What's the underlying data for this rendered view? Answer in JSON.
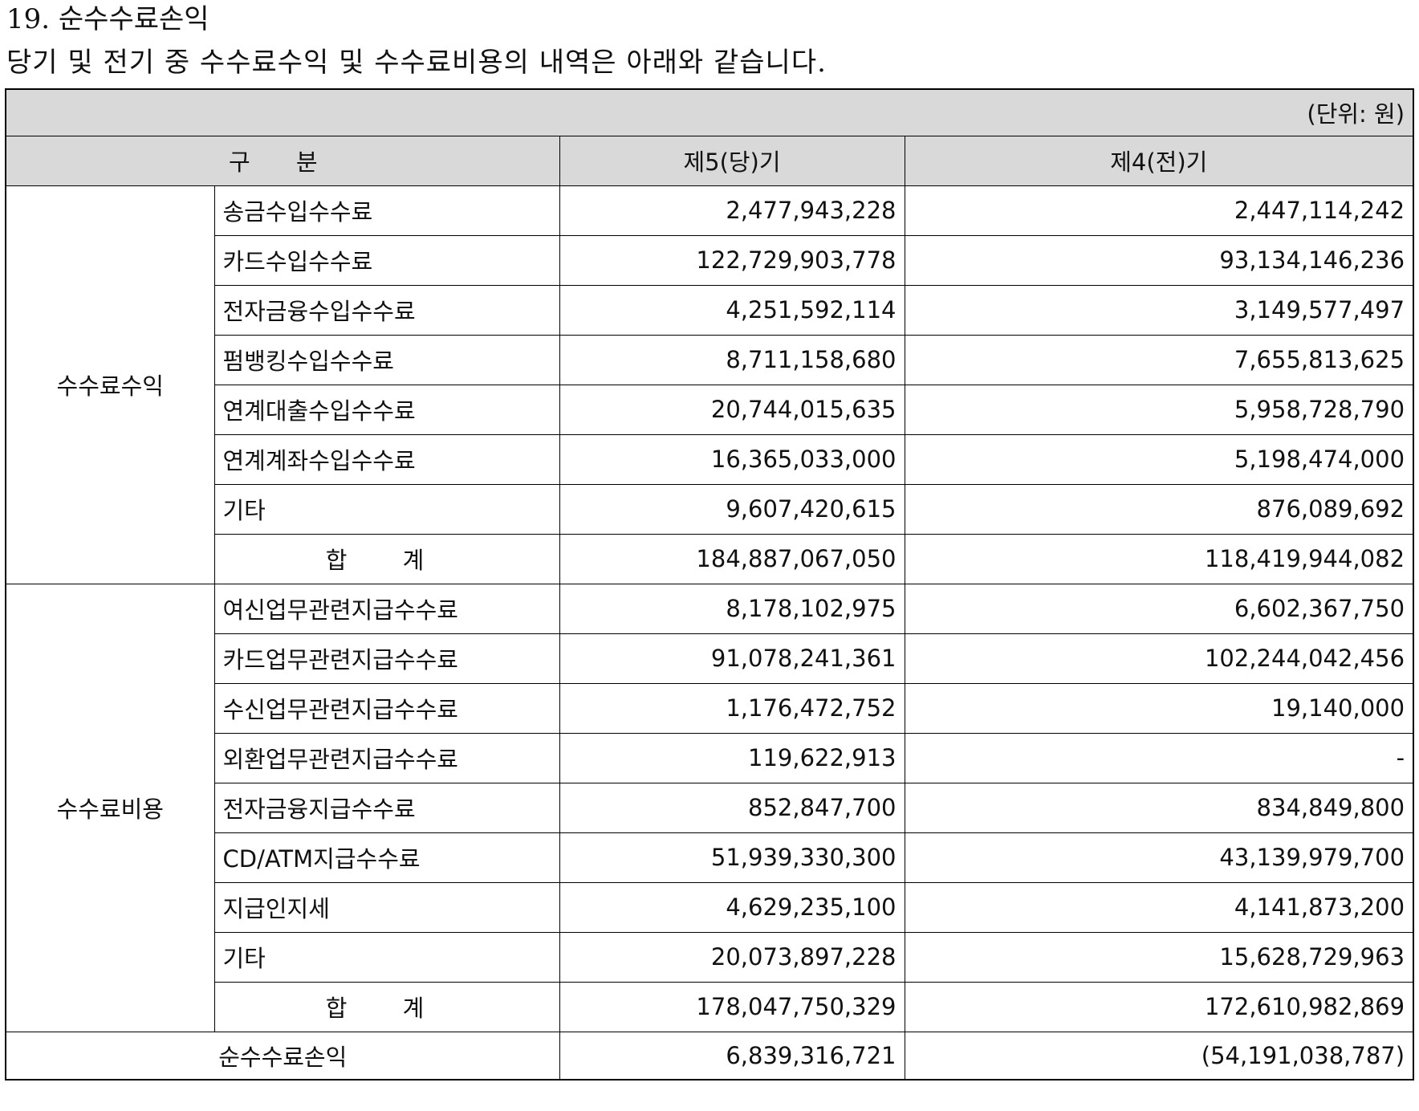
{
  "heading": "19. 순수수료손익",
  "intro": "당기 및 전기 중 수수료수익 및 수수료비용의 내역은 아래와 같습니다.",
  "unit": "(단위: 원)",
  "columns": {
    "category": "구 분",
    "current": "제5(당)기",
    "prior": "제4(전)기"
  },
  "income": {
    "label": "수수료수익",
    "rows": [
      {
        "item": "송금수입수수료",
        "current": "2,477,943,228",
        "prior": "2,447,114,242"
      },
      {
        "item": "카드수입수수료",
        "current": "122,729,903,778",
        "prior": "93,134,146,236"
      },
      {
        "item": "전자금융수입수수료",
        "current": "4,251,592,114",
        "prior": "3,149,577,497"
      },
      {
        "item": "펌뱅킹수입수수료",
        "current": "8,711,158,680",
        "prior": "7,655,813,625"
      },
      {
        "item": "연계대출수입수수료",
        "current": "20,744,015,635",
        "prior": "5,958,728,790"
      },
      {
        "item": "연계계좌수입수수료",
        "current": "16,365,033,000",
        "prior": "5,198,474,000"
      },
      {
        "item": "기타",
        "current": "9,607,420,615",
        "prior": "876,089,692"
      }
    ],
    "total": {
      "label": "합 계",
      "current": "184,887,067,050",
      "prior": "118,419,944,082"
    }
  },
  "expense": {
    "label": "수수료비용",
    "rows": [
      {
        "item": "여신업무관련지급수수료",
        "current": "8,178,102,975",
        "prior": "6,602,367,750"
      },
      {
        "item": "카드업무관련지급수수료",
        "current": "91,078,241,361",
        "prior": "102,244,042,456"
      },
      {
        "item": "수신업무관련지급수수료",
        "current": "1,176,472,752",
        "prior": "19,140,000"
      },
      {
        "item": "외환업무관련지급수수료",
        "current": "119,622,913",
        "prior": "-"
      },
      {
        "item": "전자금융지급수수료",
        "current": "852,847,700",
        "prior": "834,849,800"
      },
      {
        "item": "CD/ATM지급수수료",
        "current": "51,939,330,300",
        "prior": "43,139,979,700"
      },
      {
        "item": "지급인지세",
        "current": "4,629,235,100",
        "prior": "4,141,873,200"
      },
      {
        "item": "기타",
        "current": "20,073,897,228",
        "prior": "15,628,729,963"
      }
    ],
    "total": {
      "label": "합 계",
      "current": "178,047,750,329",
      "prior": "172,610,982,869"
    }
  },
  "net": {
    "label": "순수수료손익",
    "current": "6,839,316,721",
    "prior": "(54,191,038,787)"
  }
}
